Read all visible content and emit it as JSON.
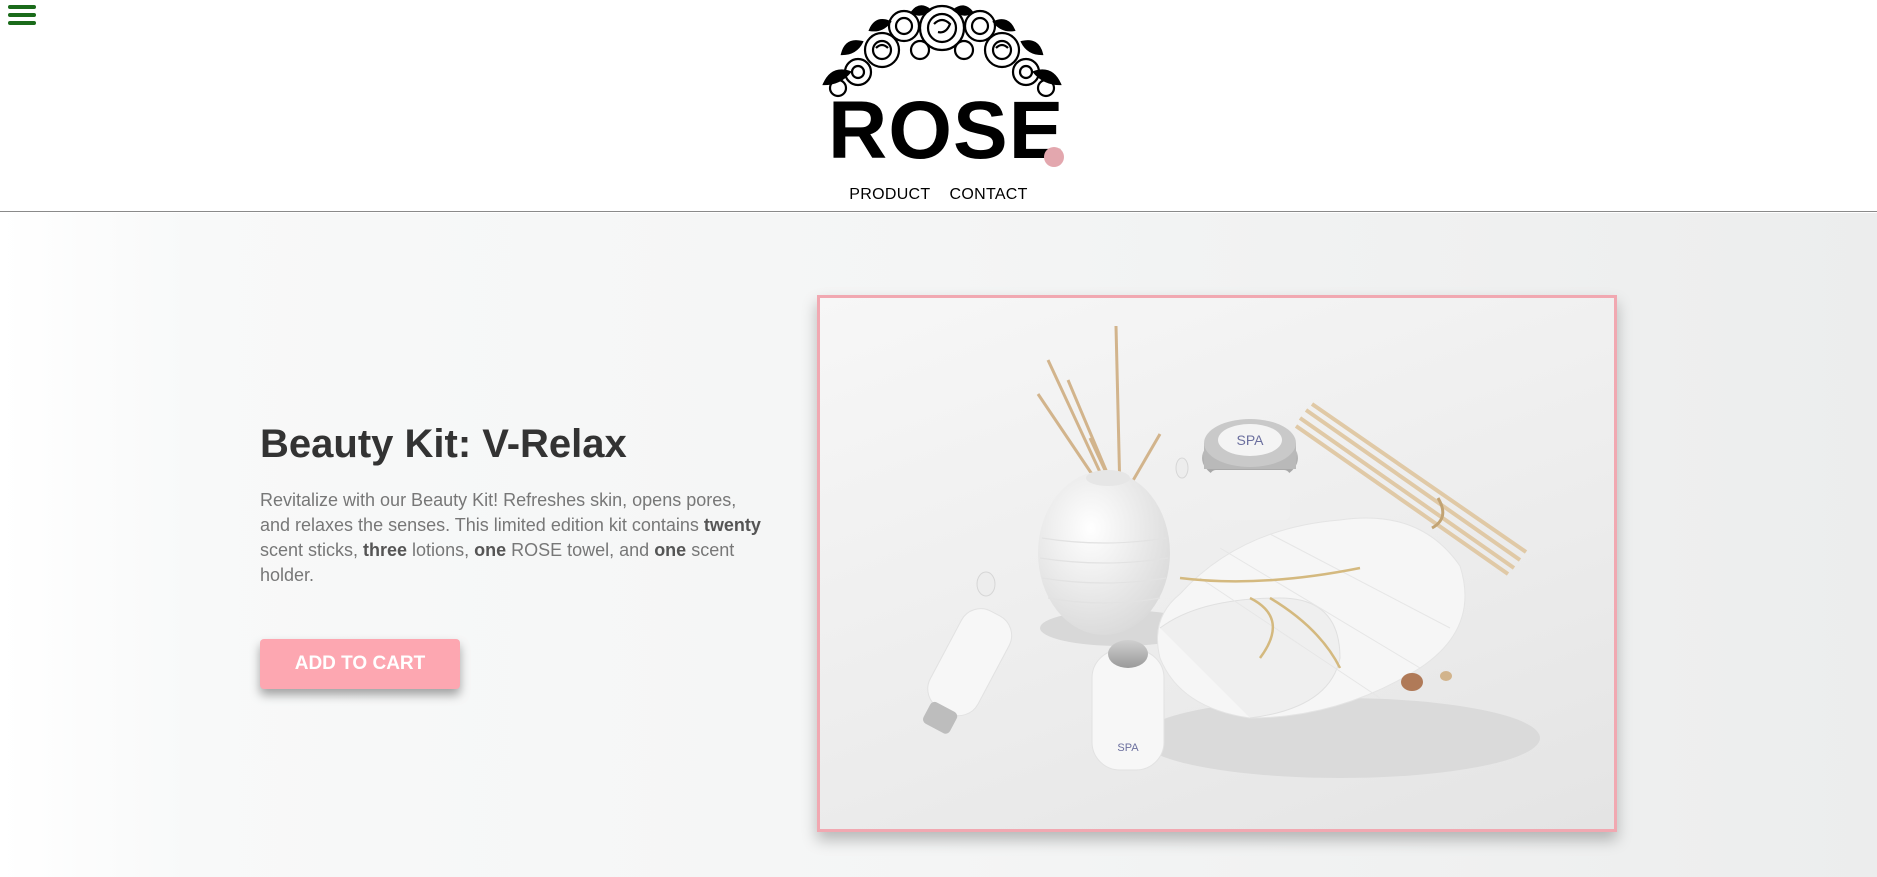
{
  "header": {
    "logo_text": "ROSE",
    "logo_dot_color": "#e3a7ae",
    "menu_icon": "hamburger-menu-icon",
    "nav": [
      {
        "label": "PRODUCT"
      },
      {
        "label": "CONTACT"
      }
    ]
  },
  "product": {
    "title": "Beauty Kit: V-Relax",
    "description_parts": {
      "intro": "Revitalize with our Beauty Kit! Refreshes skin, opens pores, and relaxes the senses. This limited edition kit contains ",
      "count1": "twenty",
      "item1": " scent sticks, ",
      "count2": "three",
      "item2": " lotions, ",
      "count3": "one",
      "item3": " ROSE towel, and ",
      "count4": "one",
      "item4": " scent holder."
    },
    "cta_label": "ADD TO CART",
    "cta_color": "#fda7b1",
    "image_label": "SPA",
    "frame_color": "#f1a8b1"
  }
}
